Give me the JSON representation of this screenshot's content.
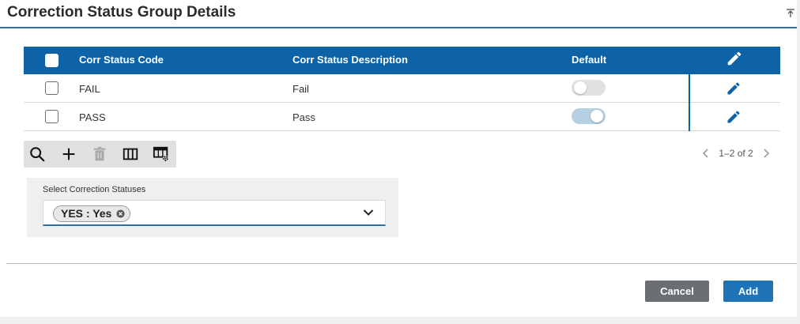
{
  "header": {
    "title": "Correction Status Group Details"
  },
  "table": {
    "columns": {
      "code": "Corr Status Code",
      "description": "Corr Status Description",
      "default": "Default"
    },
    "rows": [
      {
        "code": "FAIL",
        "description": "Fail",
        "default": false
      },
      {
        "code": "PASS",
        "description": "Pass",
        "default": true
      }
    ]
  },
  "toolbar": {
    "icons": [
      "search-icon",
      "add-icon",
      "delete-icon",
      "columns-icon",
      "table-settings-icon"
    ]
  },
  "pager": {
    "range": "1–2 of 2"
  },
  "select": {
    "label": "Select Correction Statuses",
    "selected_chip": "YES : Yes"
  },
  "actions": {
    "cancel_label": "Cancel",
    "add_label": "Add"
  },
  "colors": {
    "header_blue": "#0e63a6",
    "accent": "#2d6fa3",
    "cancel_bg": "#6b6e72",
    "add_bg": "#1f73b7",
    "toggle_on": "#b5cfe3"
  }
}
